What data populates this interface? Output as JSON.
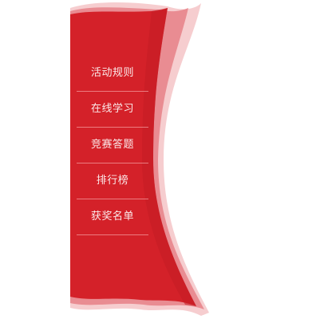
{
  "menu": {
    "items": [
      {
        "label": "活动规则"
      },
      {
        "label": "在线学习"
      },
      {
        "label": "竞赛答题"
      },
      {
        "label": "排行榜"
      },
      {
        "label": "获奖名单"
      }
    ]
  },
  "colors": {
    "ribbon_main": "#d42129",
    "ribbon_light": "#e8858b",
    "ribbon_pale": "#f4c4c7",
    "label_text": "#fbe9e9",
    "divider": "#f3b0b4"
  }
}
